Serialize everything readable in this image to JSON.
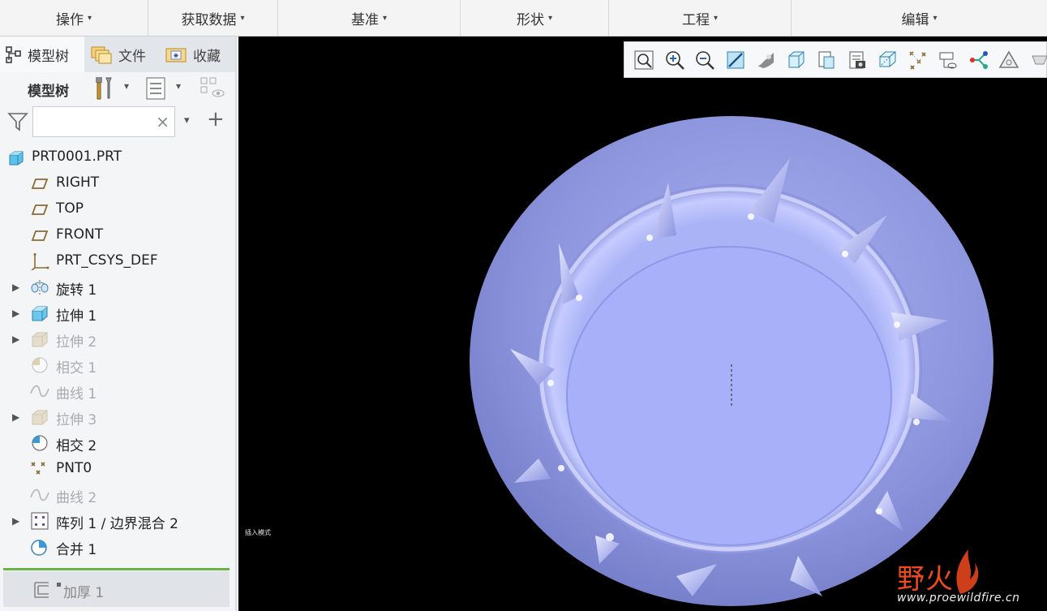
{
  "ribbon": {
    "menus": [
      {
        "label": "操作"
      },
      {
        "label": "获取数据"
      },
      {
        "label": "基准"
      },
      {
        "label": "形状"
      },
      {
        "label": "工程"
      },
      {
        "label": "编辑"
      }
    ],
    "caret": "▾"
  },
  "panel": {
    "tabs": [
      {
        "label": "模型树"
      },
      {
        "label": "文件"
      },
      {
        "label": "收藏"
      }
    ],
    "tree_title": "模型树",
    "search": {
      "value": "",
      "placeholder": "",
      "clear": "×"
    },
    "add_symbol": "+",
    "filter_caret": "▾"
  },
  "tree": {
    "expander": "▶",
    "items": [
      {
        "label": "PRT0001.PRT",
        "icon": "part-icon"
      },
      {
        "label": "RIGHT",
        "icon": "datum-plane-icon"
      },
      {
        "label": "TOP",
        "icon": "datum-plane-icon"
      },
      {
        "label": "FRONT",
        "icon": "datum-plane-icon"
      },
      {
        "label": "PRT_CSYS_DEF",
        "icon": "csys-icon"
      },
      {
        "label": "旋转 1",
        "icon": "revolve-icon",
        "expandable": true
      },
      {
        "label": "拉伸 1",
        "icon": "extrude-icon",
        "expandable": true
      },
      {
        "label": "拉伸 2",
        "icon": "extrude-icon",
        "expandable": true,
        "suppressed": true
      },
      {
        "label": "相交 1",
        "icon": "intersect-icon",
        "suppressed": true
      },
      {
        "label": "曲线 1",
        "icon": "curve-icon",
        "suppressed": true
      },
      {
        "label": "拉伸 3",
        "icon": "extrude-icon",
        "expandable": true,
        "suppressed": true
      },
      {
        "label": "相交 2",
        "icon": "intersect-icon"
      },
      {
        "label": "PNT0",
        "icon": "datum-point-icon"
      },
      {
        "label": "曲线 2",
        "icon": "curve-icon",
        "suppressed": true
      },
      {
        "label": "阵列 1 / 边界混合 2",
        "icon": "pattern-icon",
        "expandable": true
      },
      {
        "label": "合并 1",
        "icon": "merge-icon"
      }
    ],
    "insert_here": {
      "label": "加厚 1",
      "icon": "thicken-icon"
    }
  },
  "view_toolbar": {
    "buttons": [
      "refit-icon",
      "zoom-in-icon",
      "zoom-out-icon",
      "repaint-icon",
      "display-style-icon",
      "saved-orientations-icon",
      "view-manager-icon",
      "perspective-icon",
      "section-icon",
      "annotation-display-icon",
      "datum-display-icon",
      "spin-center-icon",
      "appearance-icon",
      "more-icon"
    ]
  },
  "viewport": {
    "mode_label": "插入模式",
    "background": "#000000",
    "model_color": "#a9b1f2"
  },
  "watermark": {
    "brand": "野火",
    "url": "www.proewildfire.cn",
    "color": "#f04a1c"
  }
}
